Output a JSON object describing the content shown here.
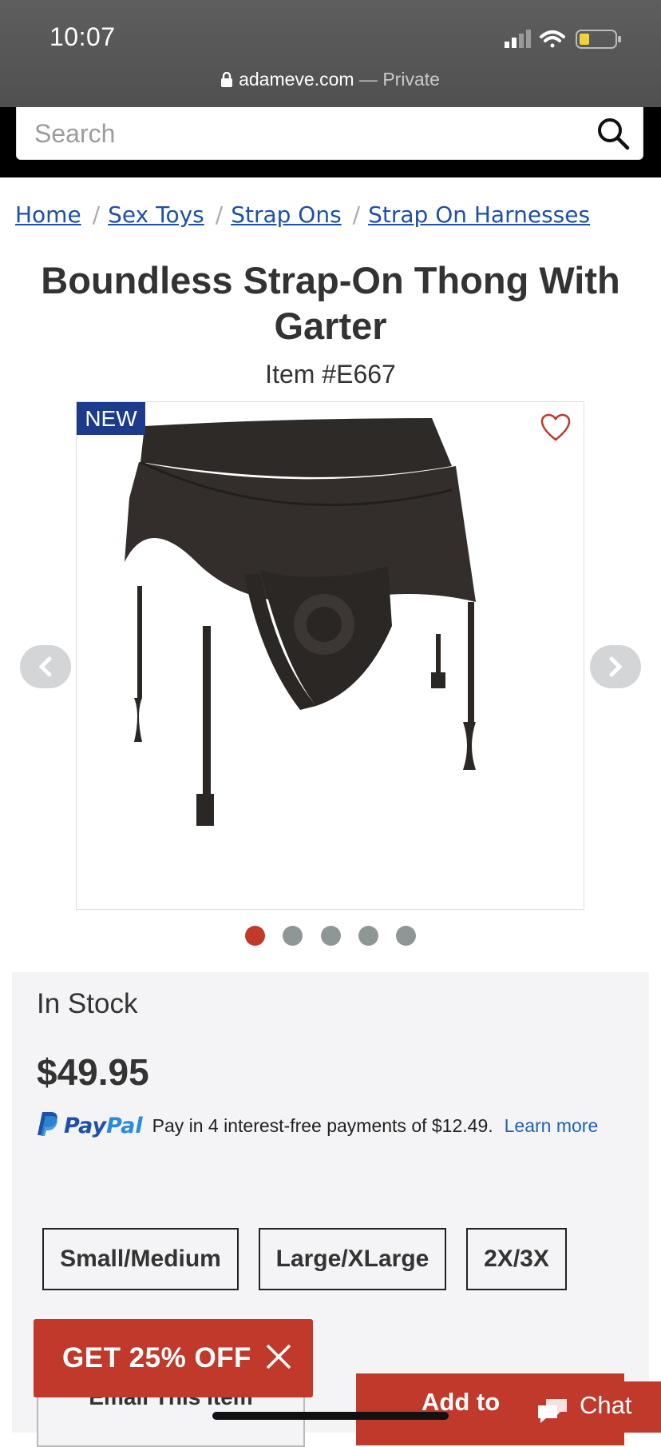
{
  "status_bar": {
    "time": "10:07"
  },
  "browser": {
    "domain": "adameve.com",
    "separator": " — ",
    "mode": "Private"
  },
  "search": {
    "placeholder": "Search"
  },
  "breadcrumb": {
    "items": [
      "Home",
      "Sex Toys",
      "Strap Ons",
      "Strap On Harnesses"
    ],
    "separator": "/"
  },
  "product": {
    "title": "Boundless Strap-On Thong With Garter",
    "item_number": "Item #E667",
    "badge": "NEW",
    "image_count": 5,
    "active_image": 1,
    "stock": "In Stock",
    "price": "$49.95",
    "paypal": {
      "logo_pay": "Pay",
      "logo_pal": "Pal",
      "message": "Pay in 4 interest-free payments of $12.49.",
      "link": "Learn more"
    },
    "sizes": [
      "Small/Medium",
      "Large/XLarge",
      "2X/3X"
    ]
  },
  "actions": {
    "email_label": "Email This Item",
    "add_label": "Add to"
  },
  "promo": {
    "label": "GET 25% OFF"
  },
  "chat": {
    "label": "Chat"
  },
  "colors": {
    "brand_red": "#c0392b",
    "badge_blue": "#1e3a8a",
    "link_blue": "#1f4fa6"
  }
}
